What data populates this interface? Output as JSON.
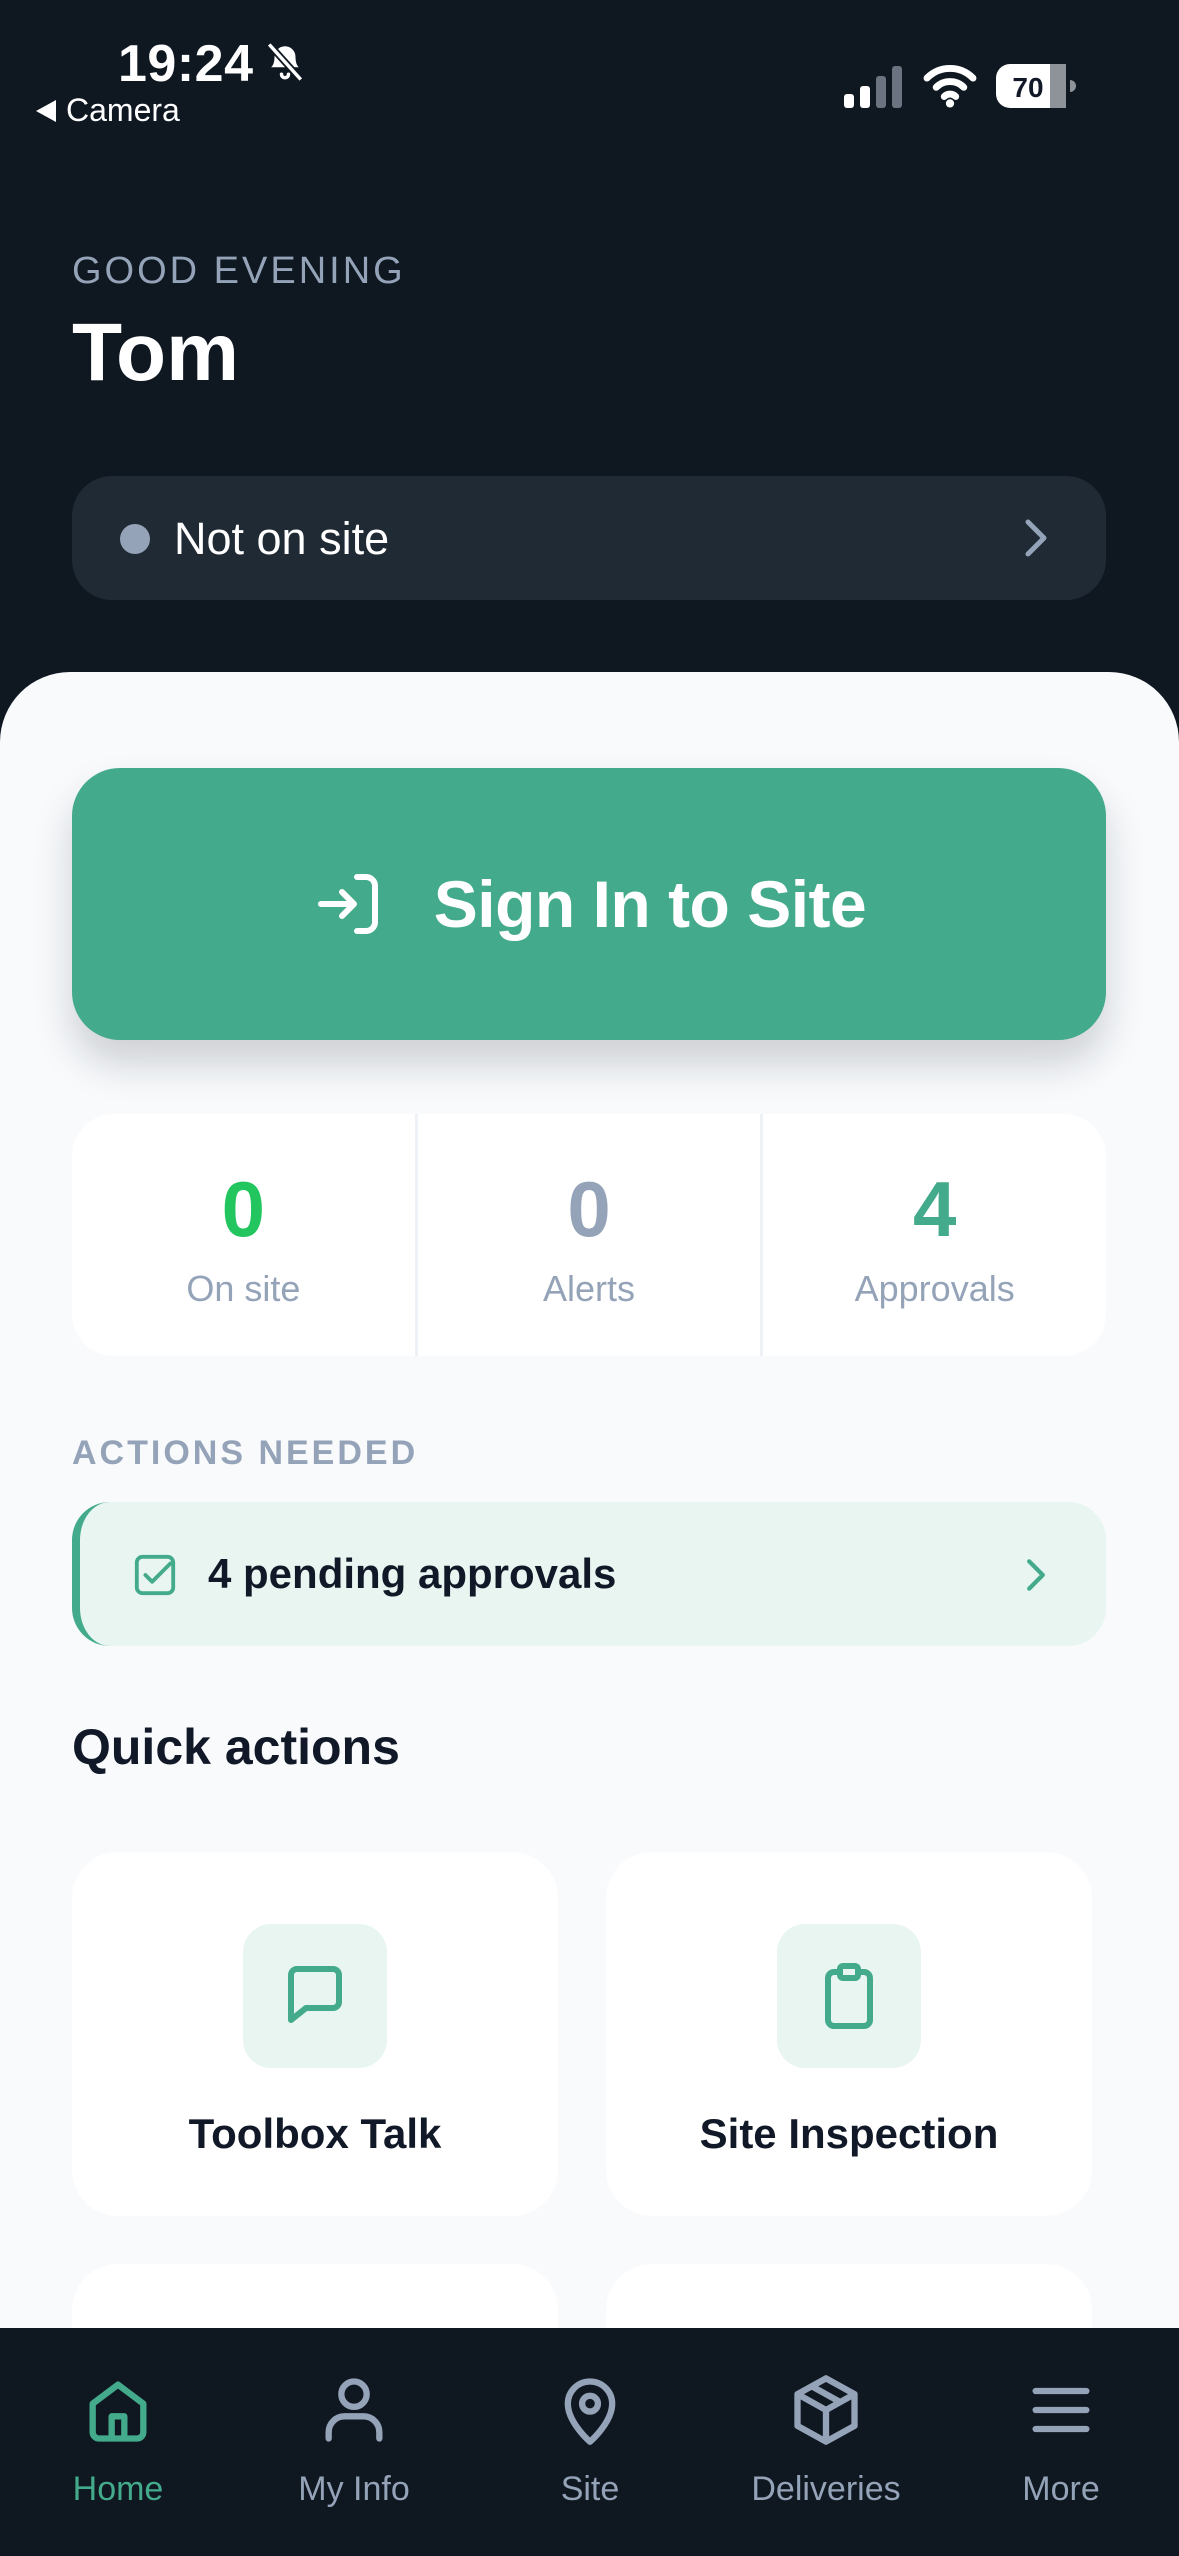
{
  "status_bar": {
    "time": "19:24",
    "back_label": "Camera",
    "battery": "70"
  },
  "header": {
    "greeting": "GOOD EVENING",
    "name": "Tom",
    "site_status": "Not on site"
  },
  "primary_action": {
    "label": "Sign In to Site"
  },
  "stats": [
    {
      "value": "0",
      "label": "On site",
      "color": "#22c55e"
    },
    {
      "value": "0",
      "label": "Alerts",
      "color": "#94a3b8"
    },
    {
      "value": "4",
      "label": "Approvals",
      "color": "#43aa8b"
    }
  ],
  "actions_needed": {
    "heading": "ACTIONS NEEDED",
    "item": "4 pending approvals"
  },
  "quick_actions": {
    "title": "Quick actions",
    "items": [
      {
        "label": "Toolbox Talk",
        "icon": "message-icon"
      },
      {
        "label": "Site Inspection",
        "icon": "clipboard-icon"
      }
    ]
  },
  "tabs": [
    {
      "label": "Home",
      "icon": "home-icon",
      "active": true
    },
    {
      "label": "My Info",
      "icon": "user-icon",
      "active": false
    },
    {
      "label": "Site",
      "icon": "map-pin-icon",
      "active": false
    },
    {
      "label": "Deliveries",
      "icon": "package-icon",
      "active": false
    },
    {
      "label": "More",
      "icon": "menu-icon",
      "active": false
    }
  ],
  "colors": {
    "brand": "#43aa8b",
    "background_dark": "#0f1721",
    "surface": "#f8fafc",
    "muted": "#94a3b8",
    "success": "#22c55e"
  }
}
